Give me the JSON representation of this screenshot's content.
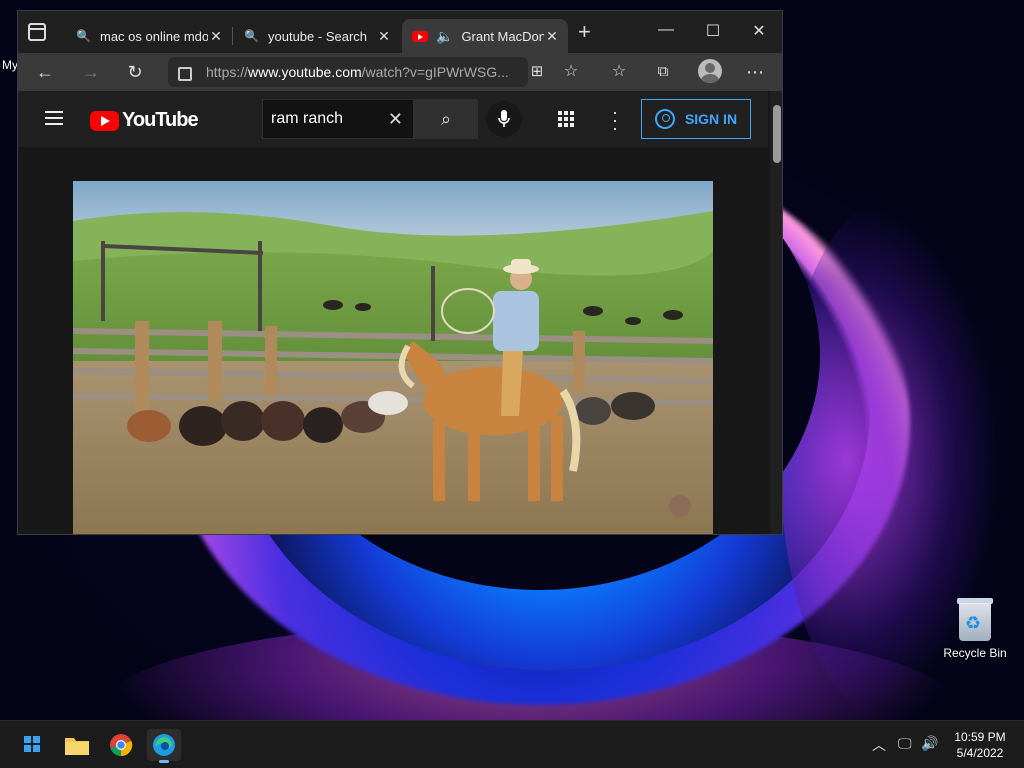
{
  "desktop": {
    "left_label": "My",
    "recycle_bin_label": "Recycle Bin"
  },
  "browser": {
    "tabs": [
      {
        "title": "mac os online mdo",
        "icon": "search-icon"
      },
      {
        "title": "youtube - Search",
        "icon": "search-icon"
      },
      {
        "title": "Grant MacDon",
        "icon": "youtube-icon",
        "audio": true,
        "active": true
      }
    ],
    "address": {
      "prefix": "https://",
      "host": "www.youtube.com",
      "path": "/watch?v=gIPWrWSG..."
    }
  },
  "youtube": {
    "logo_text": "YouTube",
    "search_value": "ram ranch",
    "sign_in_label": "SIGN IN",
    "video_alt": "Cowboy on palomino horse herding calves in a ranch corral"
  },
  "taskbar": {
    "time": "10:59 PM",
    "date": "5/4/2022"
  },
  "colors": {
    "accent_blue": "#3ea6ff",
    "youtube_red": "#ff0000"
  }
}
